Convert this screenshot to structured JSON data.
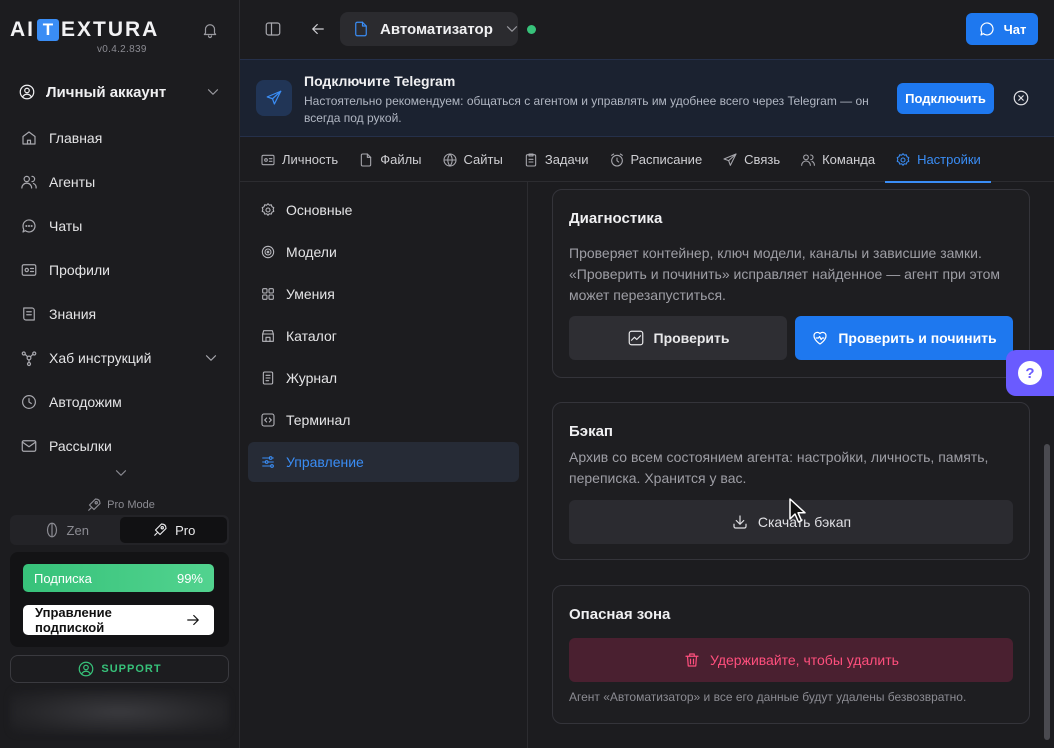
{
  "app": {
    "logo_left": "AI",
    "logo_t": "T",
    "logo_right": "EXTURA",
    "version": "v0.4.2.839"
  },
  "sidebar": {
    "account_label": "Личный аккаунт",
    "items": [
      {
        "label": "Главная",
        "icon": "home-icon"
      },
      {
        "label": "Агенты",
        "icon": "users-icon"
      },
      {
        "label": "Чаты",
        "icon": "chat-icon"
      },
      {
        "label": "Профили",
        "icon": "profile-card-icon"
      },
      {
        "label": "Знания",
        "icon": "book-icon"
      },
      {
        "label": "Хаб инструкций",
        "icon": "hub-icon"
      },
      {
        "label": "Автодожим",
        "icon": "clock-icon"
      },
      {
        "label": "Рассылки",
        "icon": "mail-icon"
      }
    ],
    "pro_mode_label": "Pro Mode",
    "mode_zen": "Zen",
    "mode_pro": "Pro",
    "subscription_label": "Подписка",
    "subscription_percent": "99%",
    "subscription_progress": 0.99,
    "manage_subscription": "Управление подпиской",
    "support_label": "SUPPORT"
  },
  "topbar": {
    "agent_name": "Автоматизатор",
    "chat_button": "Чат"
  },
  "banner": {
    "title": "Подключите Telegram",
    "text": "Настоятельно рекомендуем: общаться с агентом и управлять им удобнее всего через Telegram — он всегда под рукой.",
    "connect_button": "Подключить"
  },
  "tabs": [
    {
      "label": "Личность",
      "icon": "persona-icon"
    },
    {
      "label": "Файлы",
      "icon": "files-icon"
    },
    {
      "label": "Сайты",
      "icon": "globe-icon"
    },
    {
      "label": "Задачи",
      "icon": "tasks-icon"
    },
    {
      "label": "Расписание",
      "icon": "alarm-icon"
    },
    {
      "label": "Связь",
      "icon": "send-icon"
    },
    {
      "label": "Команда",
      "icon": "team-icon"
    },
    {
      "label": "Настройки",
      "icon": "gear-icon",
      "active": true
    }
  ],
  "settings_nav": [
    {
      "label": "Основные",
      "icon": "gear-icon"
    },
    {
      "label": "Модели",
      "icon": "model-icon"
    },
    {
      "label": "Умения",
      "icon": "grid-icon"
    },
    {
      "label": "Каталог",
      "icon": "store-icon"
    },
    {
      "label": "Журнал",
      "icon": "journal-icon"
    },
    {
      "label": "Терминал",
      "icon": "code-icon"
    },
    {
      "label": "Управление",
      "icon": "sliders-icon",
      "active": true
    }
  ],
  "diagnostics": {
    "title": "Диагностика",
    "text": "Проверяет контейнер, ключ модели, каналы и зависшие замки. «Проверить и починить» исправляет найденное — агент при этом может перезапуститься.",
    "check_button": "Проверить",
    "fix_button": "Проверить и починить"
  },
  "backup": {
    "title": "Бэкап",
    "text": "Архив со всем состоянием агента: настройки, личность, память, переписка. Хранится у вас.",
    "download_button": "Скачать бэкап"
  },
  "danger": {
    "title": "Опасная зона",
    "delete_button": "Удерживайте, чтобы удалить",
    "note": "Агент «Автоматизатор» и все его данные будут удалены безвозвратно."
  },
  "help_fab": "?"
}
